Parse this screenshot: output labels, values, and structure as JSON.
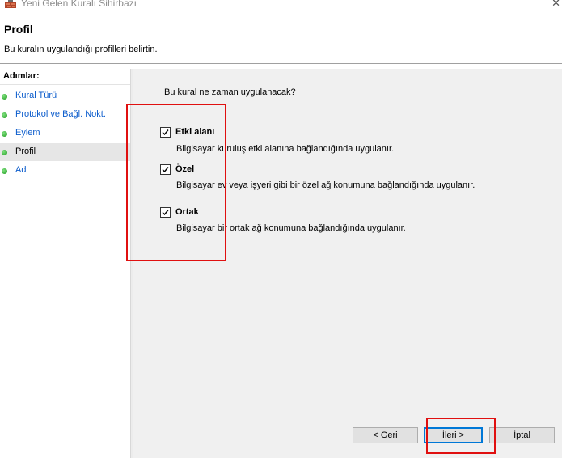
{
  "window": {
    "title": "Yeni Gelen Kuralı Sihirbazı",
    "close_glyph": "✕"
  },
  "header": {
    "title": "Profil",
    "subtitle": "Bu kuralın uygulandığı profilleri belirtin."
  },
  "sidebar": {
    "heading": "Adımlar:",
    "items": [
      {
        "label": "Kural Türü",
        "active": false
      },
      {
        "label": "Protokol ve Bağl. Nokt.",
        "active": false
      },
      {
        "label": "Eylem",
        "active": false
      },
      {
        "label": "Profil",
        "active": true
      },
      {
        "label": "Ad",
        "active": false
      }
    ]
  },
  "content": {
    "question": "Bu kural ne zaman uygulanacak?",
    "profiles": [
      {
        "label": "Etki alanı",
        "checked": true,
        "description": "Bilgisayar kuruluş etki alanına bağlandığında uygulanır."
      },
      {
        "label": "Özel",
        "checked": true,
        "description": "Bilgisayar ev veya işyeri gibi bir özel ağ konumuna bağlandığında uygulanır."
      },
      {
        "label": "Ortak",
        "checked": true,
        "description": "Bilgisayar bir ortak ağ konumuna bağlandığında uygulanır."
      }
    ]
  },
  "buttons": {
    "back": "< Geri",
    "next": "İleri >",
    "cancel": "İptal"
  },
  "colors": {
    "highlight_box": "#e01010",
    "link": "#0b5ccc",
    "step_dot": "#1e9a1e"
  }
}
